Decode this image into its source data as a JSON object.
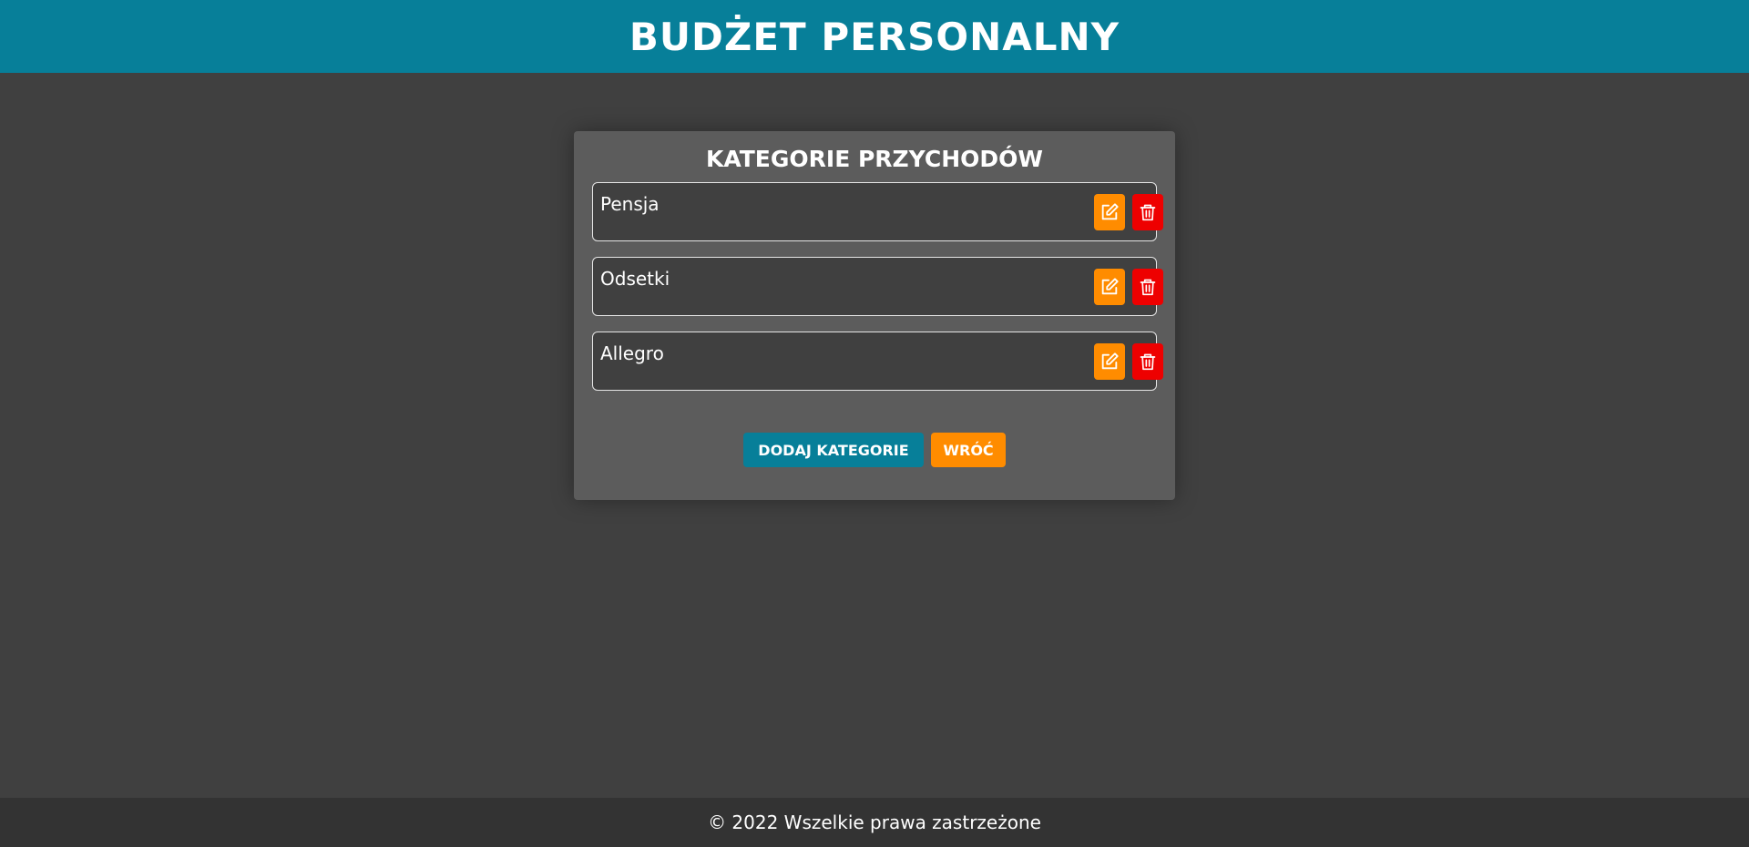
{
  "header": {
    "title": "BUDŻET PERSONALNY"
  },
  "panel": {
    "title": "KATEGORIE PRZYCHODÓW",
    "categories": [
      {
        "name": "Pensja"
      },
      {
        "name": "Odsetki"
      },
      {
        "name": "Allegro"
      }
    ],
    "icons": {
      "edit": "edit-icon",
      "delete": "trash-icon"
    },
    "buttons": {
      "add_label": "DODAJ KATEGORIE",
      "back_label": "WRÓĆ"
    }
  },
  "footer": {
    "text": "© 2022 Wszelkie prawa zastrzeżone"
  },
  "colors": {
    "brand_teal": "#077f99",
    "accent_orange": "#ff8c00",
    "danger_red": "#ee0000",
    "background": "#404040",
    "panel": "#5c5c5c",
    "footer": "#333333"
  }
}
